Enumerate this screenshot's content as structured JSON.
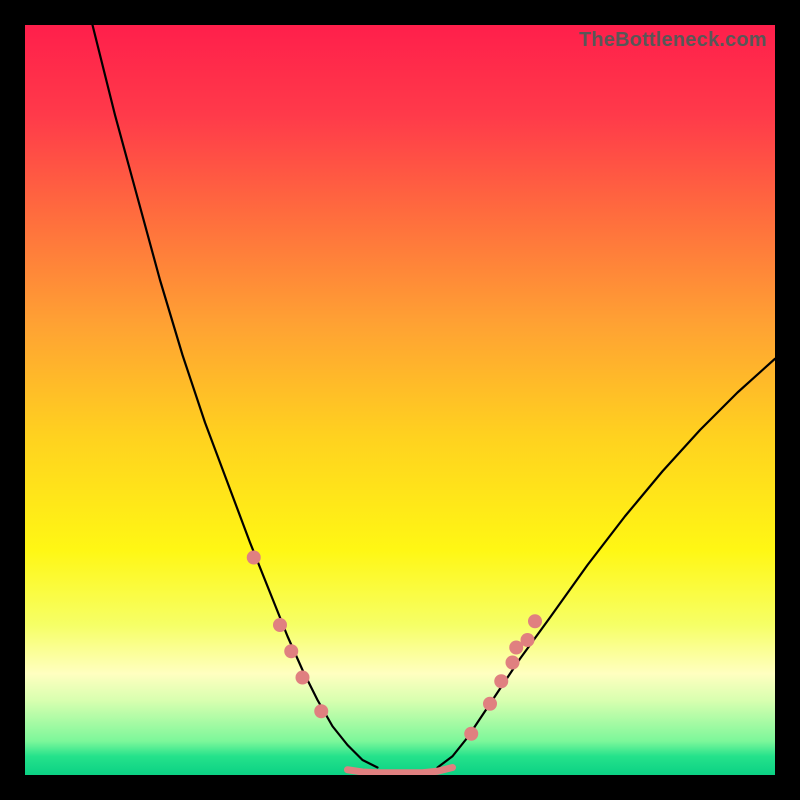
{
  "watermark": "TheBottleneck.com",
  "gradient": {
    "stops": [
      {
        "offset": 0.0,
        "color": "#ff1f4b"
      },
      {
        "offset": 0.12,
        "color": "#ff3a4a"
      },
      {
        "offset": 0.25,
        "color": "#ff6b3e"
      },
      {
        "offset": 0.4,
        "color": "#ffa233"
      },
      {
        "offset": 0.55,
        "color": "#ffd21f"
      },
      {
        "offset": 0.7,
        "color": "#fff714"
      },
      {
        "offset": 0.8,
        "color": "#f6ff66"
      },
      {
        "offset": 0.865,
        "color": "#ffffc0"
      },
      {
        "offset": 0.9,
        "color": "#d9ffb0"
      },
      {
        "offset": 0.955,
        "color": "#7cf79a"
      },
      {
        "offset": 0.975,
        "color": "#25e28b"
      },
      {
        "offset": 1.0,
        "color": "#0bd184"
      }
    ]
  },
  "chart_data": {
    "type": "line",
    "title": "",
    "xlabel": "",
    "ylabel": "",
    "xlim": [
      0,
      100
    ],
    "ylim": [
      0,
      100
    ],
    "series": [
      {
        "name": "curve-left",
        "x": [
          9,
          12,
          15,
          18,
          21,
          24,
          27,
          30,
          33,
          35,
          37,
          39,
          41,
          43,
          45,
          47
        ],
        "y": [
          100,
          88,
          77,
          66,
          56,
          47,
          39,
          31,
          23.5,
          18.5,
          14,
          10,
          6.5,
          4,
          2,
          1
        ],
        "stroke": "#000000",
        "width": 2.2
      },
      {
        "name": "curve-right",
        "x": [
          55,
          57,
          59,
          61,
          63,
          66,
          70,
          75,
          80,
          85,
          90,
          95,
          100
        ],
        "y": [
          1,
          2.5,
          5,
          8,
          11,
          15.5,
          21,
          28,
          34.5,
          40.5,
          46,
          51,
          55.5
        ],
        "stroke": "#000000",
        "width": 2.2
      },
      {
        "name": "valley-floor",
        "x": [
          43,
          45,
          47,
          49,
          51,
          53,
          55,
          57
        ],
        "y": [
          0.7,
          0.4,
          0.3,
          0.3,
          0.3,
          0.3,
          0.5,
          1
        ],
        "stroke": "#e08080",
        "width": 7
      }
    ],
    "scatter": [
      {
        "name": "dots-left",
        "points": [
          {
            "x": 30.5,
            "y": 29
          },
          {
            "x": 34.0,
            "y": 20
          },
          {
            "x": 35.5,
            "y": 16.5
          },
          {
            "x": 37.0,
            "y": 13
          },
          {
            "x": 39.5,
            "y": 8.5
          }
        ],
        "r": 7,
        "fill": "#e08080"
      },
      {
        "name": "dots-right",
        "points": [
          {
            "x": 59.5,
            "y": 5.5
          },
          {
            "x": 62.0,
            "y": 9.5
          },
          {
            "x": 63.5,
            "y": 12.5
          },
          {
            "x": 65.0,
            "y": 15
          },
          {
            "x": 65.5,
            "y": 17
          },
          {
            "x": 67.0,
            "y": 18
          },
          {
            "x": 68.0,
            "y": 20.5
          }
        ],
        "r": 7,
        "fill": "#e08080"
      }
    ]
  }
}
